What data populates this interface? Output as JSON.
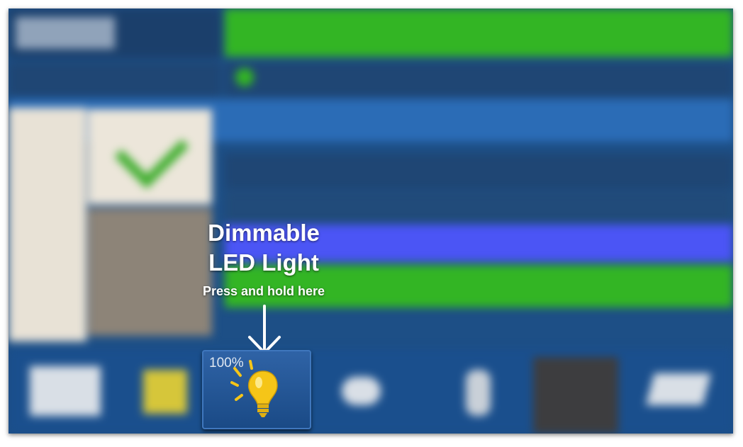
{
  "callout": {
    "title_line1": "Dimmable",
    "title_line2": "LED Light",
    "instruction": "Press and hold here"
  },
  "light_button": {
    "level": "100%",
    "icon": "lightbulb-icon"
  },
  "colors": {
    "screen_bg": "#1d4f86",
    "green_bar": "#33b524",
    "blue_highlight": "#4b55f5",
    "bulb_yellow": "#f5c518"
  }
}
